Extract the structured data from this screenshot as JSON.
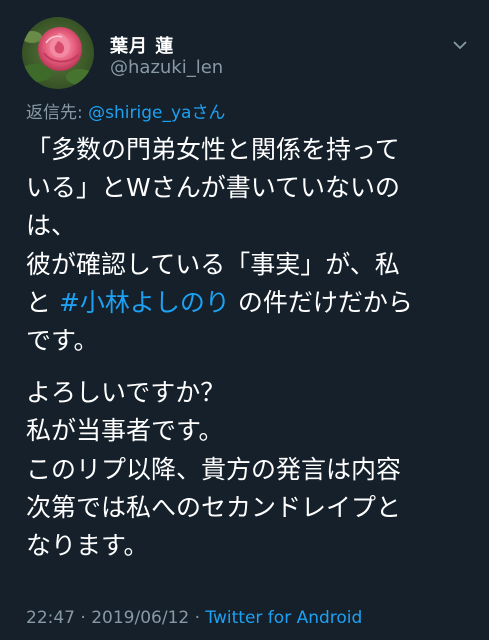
{
  "author": {
    "display_name": "葉月 蓮",
    "handle": "@hazuki_len"
  },
  "reply": {
    "prefix": "返信先:",
    "mention": "@shirige_ya",
    "suffix": "さん"
  },
  "tweet_lines": {
    "p1": [
      "「多数の門弟女性と関係を持って",
      "いる」とWさんが書いていないの",
      "は、",
      "彼が確認している「事実」が、私"
    ],
    "p1_last": {
      "before": "と ",
      "hashtag": "#小林よしのり",
      "after": " の件だけだから"
    },
    "p1_end": "です。",
    "p2": [
      "よろしいですか？",
      "私が当事者です。",
      "このリプ以降、貴方の発言は内容",
      "次第では私へのセカンドレイプと",
      "なります。"
    ]
  },
  "meta": {
    "time": "22:47",
    "separator": "·",
    "date": "2019/06/12",
    "source": "Twitter for Android"
  },
  "colors": {
    "background": "#15202b",
    "link": "#1da1f2",
    "secondary": "#8899a6"
  },
  "icons": {
    "caret": "chevron-down-icon",
    "avatar": "rose-avatar"
  }
}
